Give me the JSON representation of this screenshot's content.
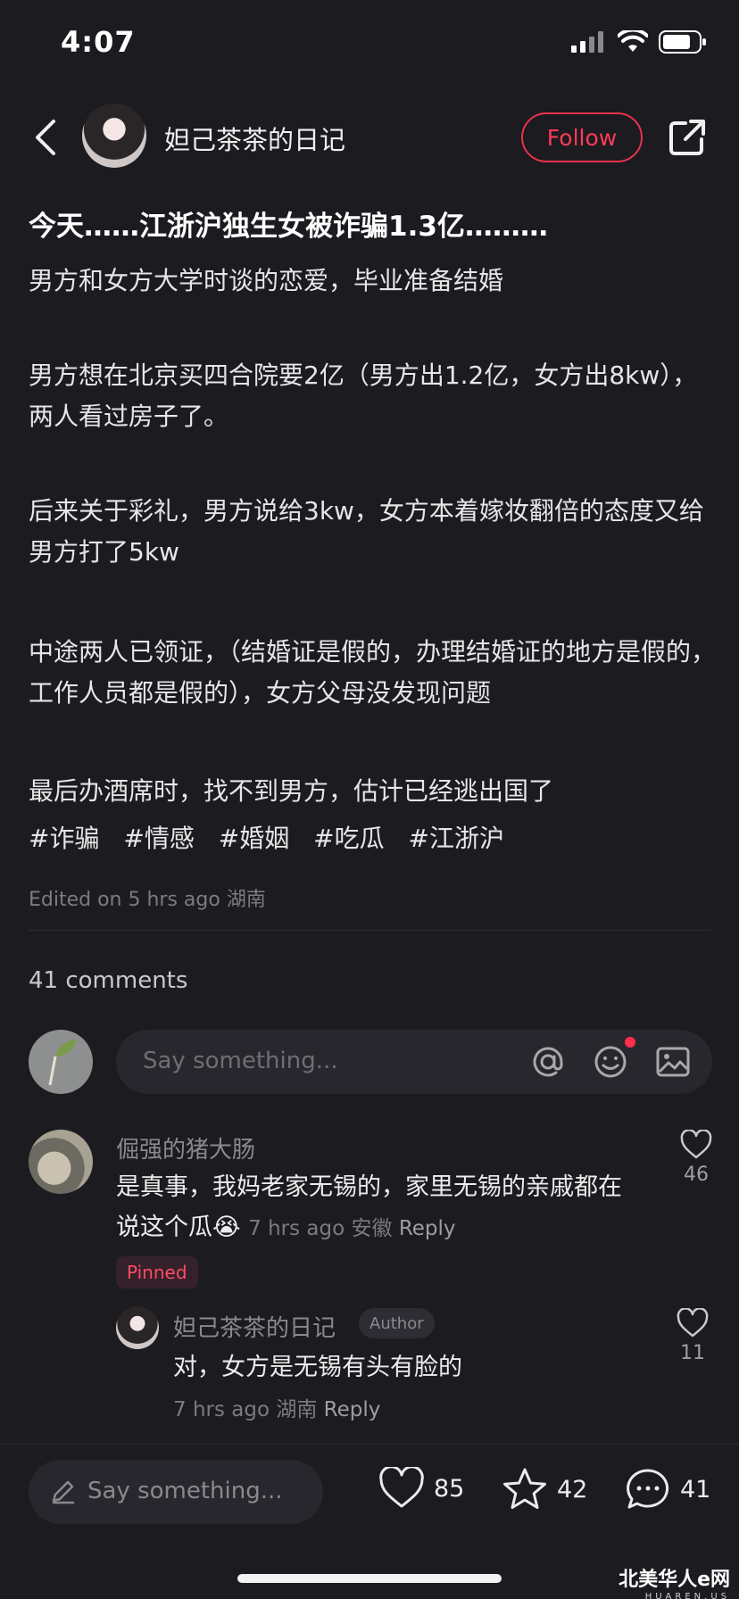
{
  "status_bar": {
    "time": "4:07"
  },
  "header": {
    "author_name": "妲己茶茶的日记",
    "follow_label": "Follow"
  },
  "post": {
    "title": "今天……江浙沪独生女被诈骗1.3亿………",
    "paragraphs": [
      "男方和女方大学时谈的恋爱，毕业准备结婚",
      "男方想在北京买四合院要2亿（男方出1.2亿，女方出8kw），两人看过房子了。",
      "后来关于彩礼，男方说给3kw，女方本着嫁妆翻倍的态度又给男方打了5kw",
      "中途两人已领证，（结婚证是假的，办理结婚证的地方是假的，工作人员都是假的），女方父母没发现问题",
      "最后办酒席时，找不到男方，估计已经逃出国了"
    ],
    "tags": [
      "#诈骗",
      "#情感",
      "#婚姻",
      "#吃瓜",
      "#江浙沪"
    ],
    "edited": "Edited on 5 hrs ago 湖南"
  },
  "comments": {
    "count_label": "41 comments",
    "input_placeholder": "Say something...",
    "items": [
      {
        "user": "倔强的猪大肠",
        "text": "是真事，我妈老家无锡的，家里无锡的亲戚都在说这个瓜",
        "emoji": "😭",
        "meta": "7 hrs ago 安徽",
        "reply_label": "Reply",
        "likes": "46",
        "pinned_label": "Pinned",
        "reply": {
          "user": "妲己茶茶的日记",
          "badge": "Author",
          "text": "对，女方是无锡有头有脸的",
          "meta": "7 hrs ago 湖南",
          "reply_label": "Reply",
          "likes": "11"
        }
      }
    ]
  },
  "bottom_bar": {
    "placeholder": "Say something...",
    "likes": "85",
    "stars": "42",
    "comments": "41"
  },
  "watermark": {
    "main": "北美华人e网",
    "sub": "HUAREN.US"
  },
  "colors": {
    "accent": "#ff3b55",
    "background": "#1c1b20"
  }
}
